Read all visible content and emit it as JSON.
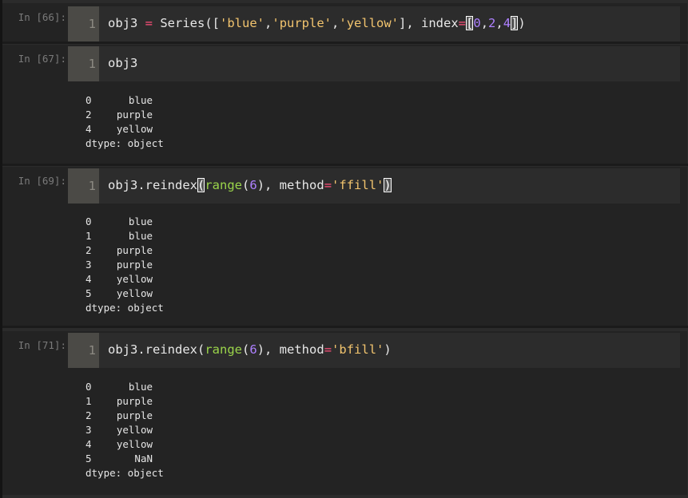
{
  "cells": [
    {
      "prompt": "In [66]:",
      "line": "1",
      "code_tokens": [
        {
          "t": "obj3 "
        },
        {
          "t": "=",
          "c": "op"
        },
        {
          "t": " Series(["
        },
        {
          "t": "'blue'",
          "c": "str"
        },
        {
          "t": ","
        },
        {
          "t": "'purple'",
          "c": "str"
        },
        {
          "t": ","
        },
        {
          "t": "'yellow'",
          "c": "str"
        },
        {
          "t": "], index"
        },
        {
          "t": "=",
          "c": "op"
        },
        {
          "t": "[",
          "c": "br"
        },
        {
          "t": "0",
          "c": "num"
        },
        {
          "t": ","
        },
        {
          "t": "2",
          "c": "num"
        },
        {
          "t": ","
        },
        {
          "t": "4",
          "c": "num"
        },
        {
          "t": "]",
          "c": "br"
        },
        {
          "t": ")"
        }
      ],
      "output": null
    },
    {
      "prompt": "In [67]:",
      "line": "1",
      "code_tokens": [
        {
          "t": "obj3"
        }
      ],
      "output": {
        "rows": [
          [
            "0",
            "blue"
          ],
          [
            "2",
            "purple"
          ],
          [
            "4",
            "yellow"
          ]
        ],
        "dtype": "dtype: object"
      }
    },
    {
      "prompt": "In [69]:",
      "line": "1",
      "code_tokens": [
        {
          "t": "obj3.reindex"
        },
        {
          "t": "(",
          "c": "br"
        },
        {
          "t": "range",
          "c": "fn"
        },
        {
          "t": "("
        },
        {
          "t": "6",
          "c": "num"
        },
        {
          "t": "), method"
        },
        {
          "t": "=",
          "c": "op"
        },
        {
          "t": "'ffill'",
          "c": "str"
        },
        {
          "t": ")",
          "c": "br"
        }
      ],
      "output": {
        "rows": [
          [
            "0",
            "blue"
          ],
          [
            "1",
            "blue"
          ],
          [
            "2",
            "purple"
          ],
          [
            "3",
            "purple"
          ],
          [
            "4",
            "yellow"
          ],
          [
            "5",
            "yellow"
          ]
        ],
        "dtype": "dtype: object"
      }
    },
    {
      "prompt": "In [71]:",
      "line": "1",
      "code_tokens": [
        {
          "t": "obj3.reindex("
        },
        {
          "t": "range",
          "c": "fn"
        },
        {
          "t": "("
        },
        {
          "t": "6",
          "c": "num"
        },
        {
          "t": "), method"
        },
        {
          "t": "=",
          "c": "op"
        },
        {
          "t": "'bfill'",
          "c": "str"
        },
        {
          "t": ")"
        }
      ],
      "output": {
        "rows": [
          [
            "0",
            "blue"
          ],
          [
            "1",
            "purple"
          ],
          [
            "2",
            "purple"
          ],
          [
            "3",
            "yellow"
          ],
          [
            "4",
            "yellow"
          ],
          [
            "5",
            "NaN"
          ]
        ],
        "dtype": "dtype: object"
      }
    }
  ]
}
